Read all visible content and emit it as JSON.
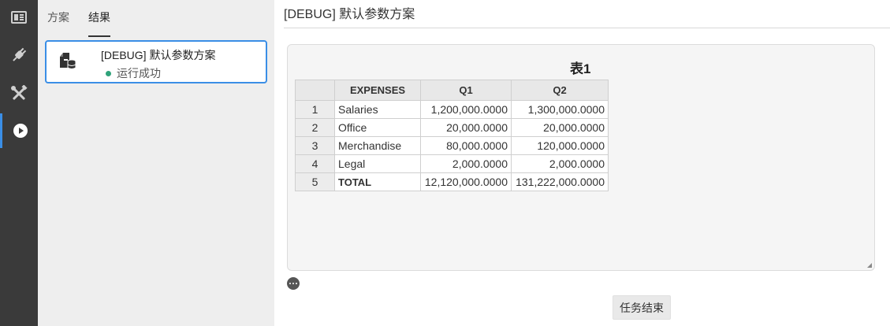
{
  "rail": {
    "items": [
      {
        "icon": "panel-layout-icon"
      },
      {
        "icon": "plug-icon"
      },
      {
        "icon": "tools-icon"
      },
      {
        "icon": "play-circle-icon",
        "active": true
      }
    ],
    "colors": {
      "background": "#3a3a3a",
      "active_accent": "#3a8ee6"
    }
  },
  "side": {
    "tabs": [
      {
        "label": "方案"
      },
      {
        "label": "结果",
        "active": true
      }
    ],
    "run": {
      "title": "[DEBUG] 默认参数方案",
      "status": "运行成功",
      "status_color": "#2fa37a",
      "icon": "document-database-icon"
    }
  },
  "main": {
    "title": "[DEBUG] 默认参数方案",
    "table": {
      "caption": "表1",
      "columns": [
        "",
        "EXPENSES",
        "Q1",
        "Q2"
      ],
      "rows": [
        {
          "idx": "1",
          "name": "Salaries",
          "q1": "1,200,000.0000",
          "q2": "1,300,000.0000"
        },
        {
          "idx": "2",
          "name": "Office",
          "q1": "20,000.0000",
          "q2": "20,000.0000"
        },
        {
          "idx": "3",
          "name": "Merchandise",
          "q1": "80,000.0000",
          "q2": "120,000.0000"
        },
        {
          "idx": "4",
          "name": "Legal",
          "q1": "2,000.0000",
          "q2": "2,000.0000"
        },
        {
          "idx": "5",
          "name": "TOTAL",
          "q1": "12,120,000.0000",
          "q2": "131,222,000.0000"
        }
      ]
    },
    "more_icon": "more-dots-icon",
    "end_button_label": "任务结束"
  }
}
